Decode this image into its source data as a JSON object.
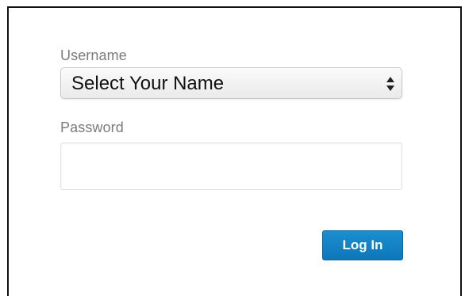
{
  "form": {
    "username_label": "Username",
    "username_selected": "Select Your Name",
    "password_label": "Password",
    "password_value": "",
    "submit_label": "Log In"
  },
  "icons": {
    "select_arrows": "up-down-chevron-icon"
  },
  "colors": {
    "button_bg": "#0e76b9",
    "label_text": "#7b7b7b",
    "panel_border": "#111111"
  }
}
